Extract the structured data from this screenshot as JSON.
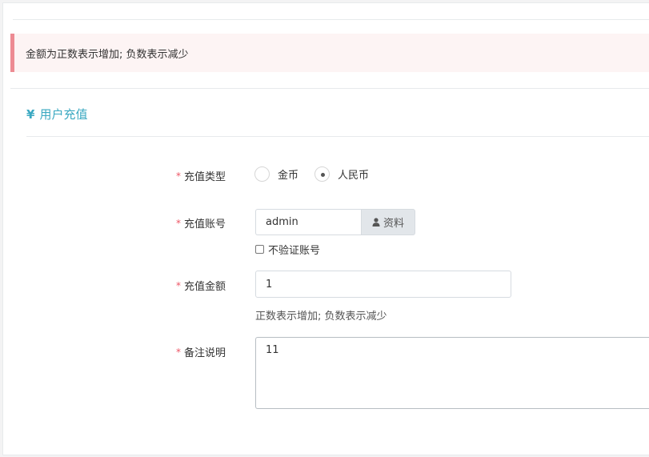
{
  "alert": {
    "text": "金额为正数表示增加; 负数表示减少"
  },
  "section": {
    "title": "用户充值",
    "icon": "yen-icon"
  },
  "form": {
    "required_mark": "*",
    "type": {
      "label": "充值类型",
      "options": [
        {
          "label": "金币",
          "checked": false
        },
        {
          "label": "人民币",
          "checked": true
        }
      ]
    },
    "account": {
      "label": "充值账号",
      "value": "admin",
      "addon_label": "资料",
      "addon_icon": "user-icon",
      "checkbox_label": "不验证账号",
      "checkbox_checked": false
    },
    "amount": {
      "label": "充值金额",
      "value": "1",
      "help": "正数表示增加; 负数表示减少"
    },
    "remark": {
      "label": "备注说明",
      "value": "11"
    }
  },
  "colors": {
    "accent": "#3aa8c1",
    "alert_border": "#ed8b93",
    "alert_bg": "#fdf4f4",
    "required": "#ed5565"
  }
}
